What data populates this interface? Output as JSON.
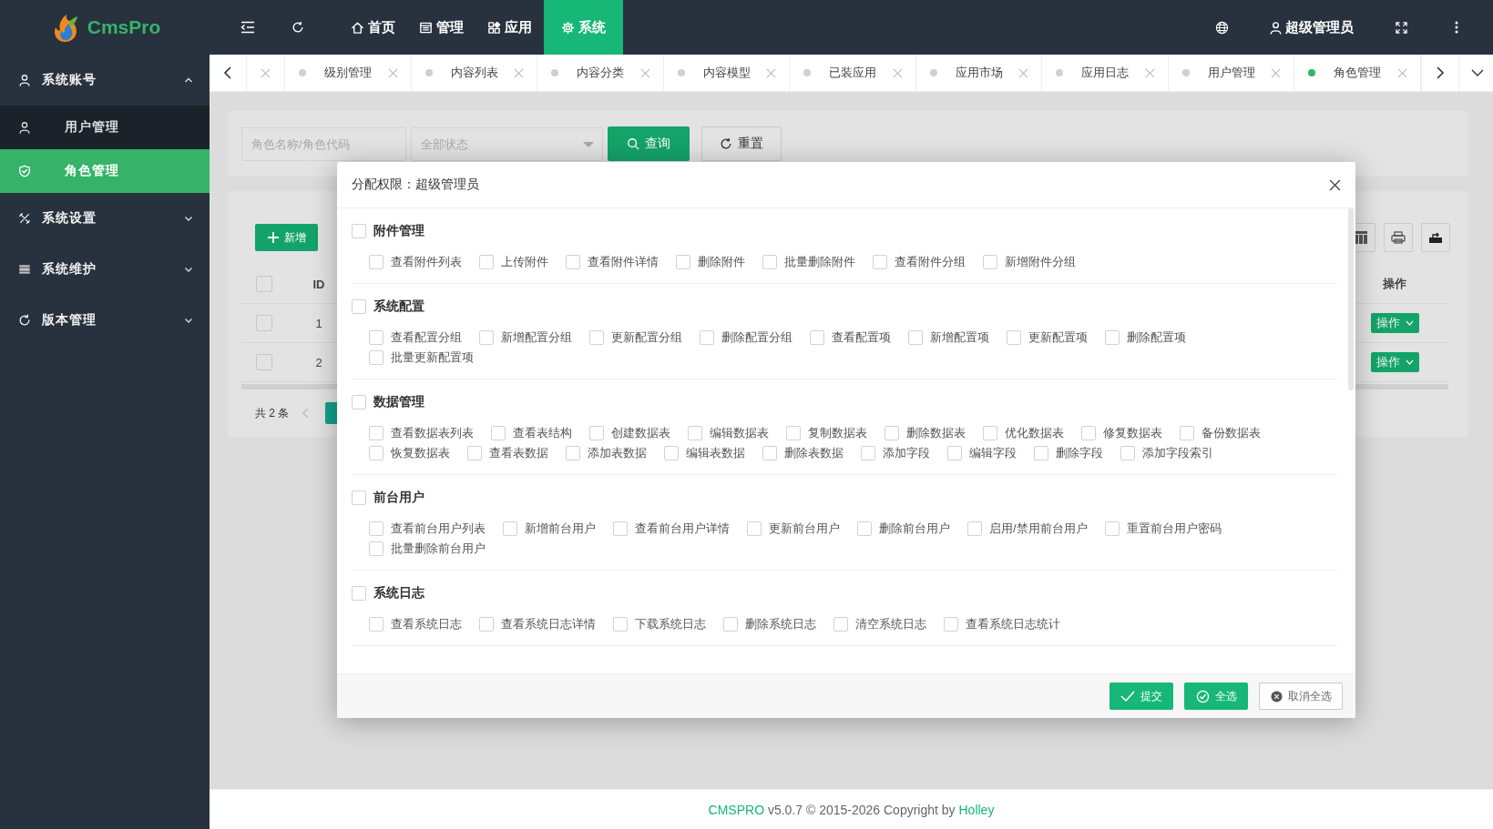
{
  "app": {
    "logo": "CmsPro"
  },
  "topbar": {
    "nav": [
      {
        "label": "首页",
        "selected": false
      },
      {
        "label": "管理",
        "selected": false
      },
      {
        "label": "应用",
        "selected": false
      },
      {
        "label": "系统",
        "selected": true
      }
    ],
    "user": "超级管理员"
  },
  "sidebar": {
    "groups": [
      {
        "label": "系统账号",
        "expanded": true,
        "children": [
          {
            "label": "用户管理",
            "selected": false
          },
          {
            "label": "角色管理",
            "selected": true
          }
        ]
      },
      {
        "label": "系统设置",
        "expanded": false
      },
      {
        "label": "系统维护",
        "expanded": false
      },
      {
        "label": "版本管理",
        "expanded": false
      }
    ]
  },
  "tabs": [
    {
      "label": "级别管理",
      "selected": false
    },
    {
      "label": "内容列表",
      "selected": false
    },
    {
      "label": "内容分类",
      "selected": false
    },
    {
      "label": "内容模型",
      "selected": false
    },
    {
      "label": "已装应用",
      "selected": false
    },
    {
      "label": "应用市场",
      "selected": false
    },
    {
      "label": "应用日志",
      "selected": false
    },
    {
      "label": "用户管理",
      "selected": false
    },
    {
      "label": "角色管理",
      "selected": true
    }
  ],
  "search": {
    "placeholder": "角色名称/角色代码",
    "status_placeholder": "全部状态",
    "query_button": "查询",
    "reset_button": "重置"
  },
  "table": {
    "add_button": "新增",
    "header_checked": false,
    "columns": [
      {
        "label": "ID"
      },
      {
        "label": "操作"
      }
    ],
    "rows": [
      {
        "id": "1",
        "action": "操作",
        "checked": false
      },
      {
        "id": "2",
        "action": "操作",
        "checked": false
      }
    ],
    "total": "共 2 条"
  },
  "dialog": {
    "title": "分配权限：超级管理员",
    "groups": [
      {
        "label": "附件管理",
        "checked": false,
        "permissions": [
          {
            "label": "查看附件列表",
            "checked": false
          },
          {
            "label": "上传附件",
            "checked": false
          },
          {
            "label": "查看附件详情",
            "checked": false
          },
          {
            "label": "删除附件",
            "checked": false
          },
          {
            "label": "批量删除附件",
            "checked": false
          },
          {
            "label": "查看附件分组",
            "checked": false
          },
          {
            "label": "新增附件分组",
            "checked": false
          }
        ]
      },
      {
        "label": "系统配置",
        "checked": false,
        "permissions": [
          {
            "label": "查看配置分组",
            "checked": false
          },
          {
            "label": "新增配置分组",
            "checked": false
          },
          {
            "label": "更新配置分组",
            "checked": false
          },
          {
            "label": "删除配置分组",
            "checked": false
          },
          {
            "label": "查看配置项",
            "checked": false
          },
          {
            "label": "新增配置项",
            "checked": false
          },
          {
            "label": "更新配置项",
            "checked": false
          },
          {
            "label": "删除配置项",
            "checked": false
          },
          {
            "label": "批量更新配置项",
            "checked": false
          }
        ]
      },
      {
        "label": "数据管理",
        "checked": false,
        "permissions": [
          {
            "label": "查看数据表列表",
            "checked": false
          },
          {
            "label": "查看表结构",
            "checked": false
          },
          {
            "label": "创建数据表",
            "checked": false
          },
          {
            "label": "编辑数据表",
            "checked": false
          },
          {
            "label": "复制数据表",
            "checked": false
          },
          {
            "label": "删除数据表",
            "checked": false
          },
          {
            "label": "优化数据表",
            "checked": false
          },
          {
            "label": "修复数据表",
            "checked": false
          },
          {
            "label": "备份数据表",
            "checked": false
          },
          {
            "label": "恢复数据表",
            "checked": false
          },
          {
            "label": "查看表数据",
            "checked": false
          },
          {
            "label": "添加表数据",
            "checked": false
          },
          {
            "label": "编辑表数据",
            "checked": false
          },
          {
            "label": "删除表数据",
            "checked": false
          },
          {
            "label": "添加字段",
            "checked": false
          },
          {
            "label": "编辑字段",
            "checked": false
          },
          {
            "label": "删除字段",
            "checked": false
          },
          {
            "label": "添加字段索引",
            "checked": false
          }
        ]
      },
      {
        "label": "前台用户",
        "checked": false,
        "permissions": [
          {
            "label": "查看前台用户列表",
            "checked": false
          },
          {
            "label": "新增前台用户",
            "checked": false
          },
          {
            "label": "查看前台用户详情",
            "checked": false
          },
          {
            "label": "更新前台用户",
            "checked": false
          },
          {
            "label": "删除前台用户",
            "checked": false
          },
          {
            "label": "启用/禁用前台用户",
            "checked": false
          },
          {
            "label": "重置前台用户密码",
            "checked": false
          },
          {
            "label": "批量删除前台用户",
            "checked": false
          }
        ]
      },
      {
        "label": "系统日志",
        "checked": false,
        "permissions": [
          {
            "label": "查看系统日志",
            "checked": false
          },
          {
            "label": "查看系统日志详情",
            "checked": false
          },
          {
            "label": "下载系统日志",
            "checked": false
          },
          {
            "label": "删除系统日志",
            "checked": false
          },
          {
            "label": "清空系统日志",
            "checked": false
          },
          {
            "label": "查看系统日志统计",
            "checked": false
          }
        ]
      }
    ],
    "buttons": [
      {
        "label": "提交",
        "kind": "submit"
      },
      {
        "label": "全选",
        "kind": "select_all"
      },
      {
        "label": "取消全选",
        "kind": "clear"
      }
    ]
  },
  "footer": {
    "brand": "CMSPRO",
    "text": "v5.0.7 © 2015-2026 Copyright by",
    "author": "Holley"
  }
}
